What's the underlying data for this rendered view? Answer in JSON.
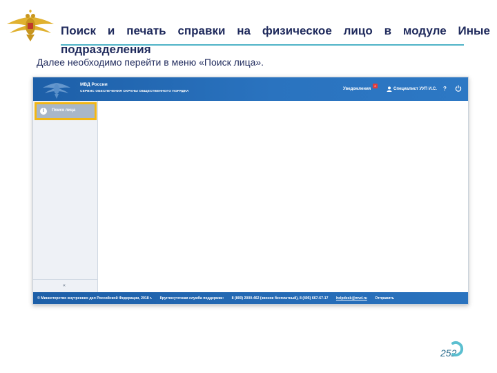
{
  "slide": {
    "title_line1": "Поиск и печать справки на физическое лицо в модуле Иные",
    "title_line2": "подразделения",
    "subtitle": "Далее необходимо перейти в меню «Поиск лица».",
    "page_number": "252"
  },
  "app": {
    "header": {
      "name": "МВД России",
      "service": "СЕРВИС ОБЕСПЕЧЕНИЯ ОХРАНЫ ОБЩЕСТВЕННОГО ПОРЯДКА",
      "notifications_label": "Уведомления",
      "notifications_count": "2",
      "user_name": "Специалист УУП И.С.",
      "help_label": "?"
    },
    "sidebar": {
      "items": [
        {
          "label": "Поиск лица",
          "icon": "info-icon"
        }
      ],
      "collapse_label": "«"
    },
    "footer": {
      "copyright": "© Министерство внутренних дел Российской Федерации, 2018 г.",
      "support_label": "Круглосуточная служба поддержки:",
      "phones": "8 (800) 2000-462 (звонок бесплатный), 8 (495) 667-67-17",
      "email": "helpdesk@mvd.ru",
      "send_label": "Отправить"
    },
    "colors": {
      "header_blue": "#2a73bf",
      "highlight": "#f2b715",
      "sidebar_selected": "#a9b7c8"
    }
  }
}
